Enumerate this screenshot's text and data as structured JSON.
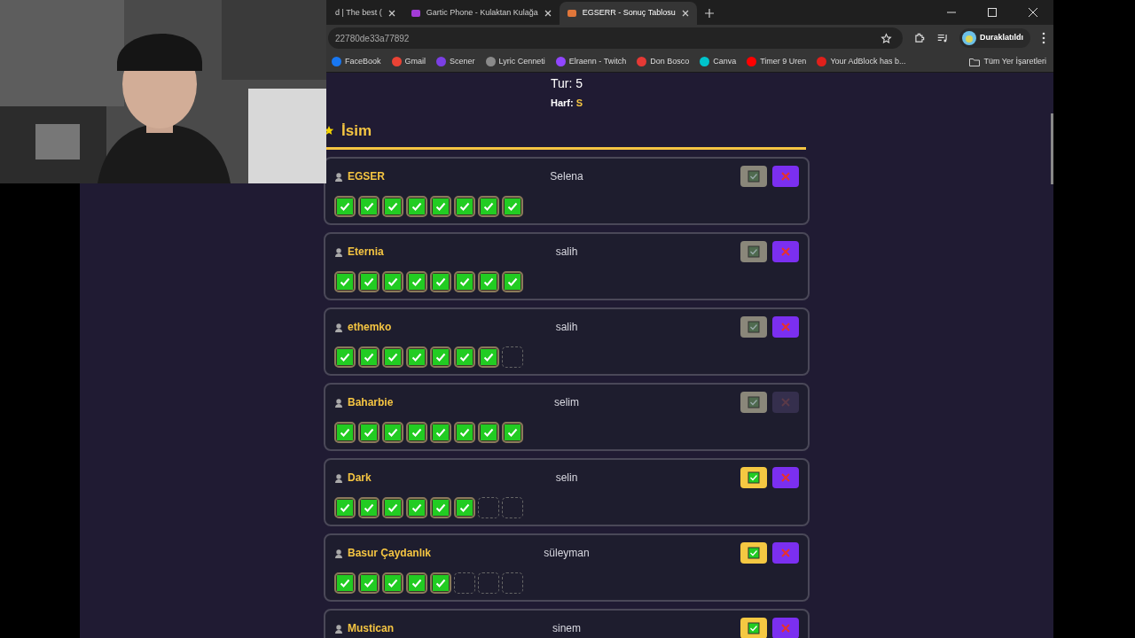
{
  "browser": {
    "tabs": [
      {
        "title": "d | The best (",
        "selected": false
      },
      {
        "title": "Gartic Phone - Kulaktan Kulağa",
        "selected": false
      },
      {
        "title": "EGSERR - Sonuç Tablosu",
        "selected": true
      }
    ],
    "address": "22780de33a77892",
    "profile": "Duraklatıldı",
    "bookmarks": [
      {
        "label": "FaceBook",
        "color": "#1877f2"
      },
      {
        "label": "Gmail",
        "color": "#ea4335"
      },
      {
        "label": "Scener",
        "color": "#7b3fe4"
      },
      {
        "label": "Lyric Cenneti",
        "color": "#8a8a8a"
      },
      {
        "label": "Elraenn - Twitch",
        "color": "#9146ff"
      },
      {
        "label": "Don Bosco",
        "color": "#e53935"
      },
      {
        "label": "Canva",
        "color": "#00c4cc"
      },
      {
        "label": "Timer 9 Uren",
        "color": "#ff0000"
      },
      {
        "label": "Your AdBlock has b...",
        "color": "#e0201b"
      }
    ],
    "bookmarks_folder": "Tüm Yer İşaretleri"
  },
  "game": {
    "round": "Tur: 5",
    "letter_label": "Harf:",
    "letter": "S",
    "category": "İsim",
    "players": [
      {
        "name": "EGSER",
        "answer": "Selena",
        "votes": [
          true,
          true,
          true,
          true,
          true,
          true,
          true,
          true
        ],
        "approve_enabled": false,
        "reject_enabled": true
      },
      {
        "name": "Eternia",
        "answer": "salih",
        "votes": [
          true,
          true,
          true,
          true,
          true,
          true,
          true,
          true
        ],
        "approve_enabled": false,
        "reject_enabled": true
      },
      {
        "name": "ethemko",
        "answer": "salih",
        "votes": [
          true,
          true,
          true,
          true,
          true,
          true,
          true,
          false
        ],
        "approve_enabled": false,
        "reject_enabled": true
      },
      {
        "name": "Baharbie",
        "answer": "selim",
        "votes": [
          true,
          true,
          true,
          true,
          true,
          true,
          true,
          true
        ],
        "approve_enabled": false,
        "reject_enabled": false
      },
      {
        "name": "Dark",
        "answer": "selin",
        "votes": [
          true,
          true,
          true,
          true,
          true,
          true,
          false,
          false
        ],
        "approve_enabled": true,
        "reject_enabled": true
      },
      {
        "name": "Basur Çaydanlık",
        "answer": "süleyman",
        "votes": [
          true,
          true,
          true,
          true,
          true,
          false,
          false,
          false
        ],
        "approve_enabled": true,
        "reject_enabled": true
      },
      {
        "name": "Mustican",
        "answer": "sinem",
        "approve_enabled": true,
        "reject_enabled": true
      }
    ]
  }
}
